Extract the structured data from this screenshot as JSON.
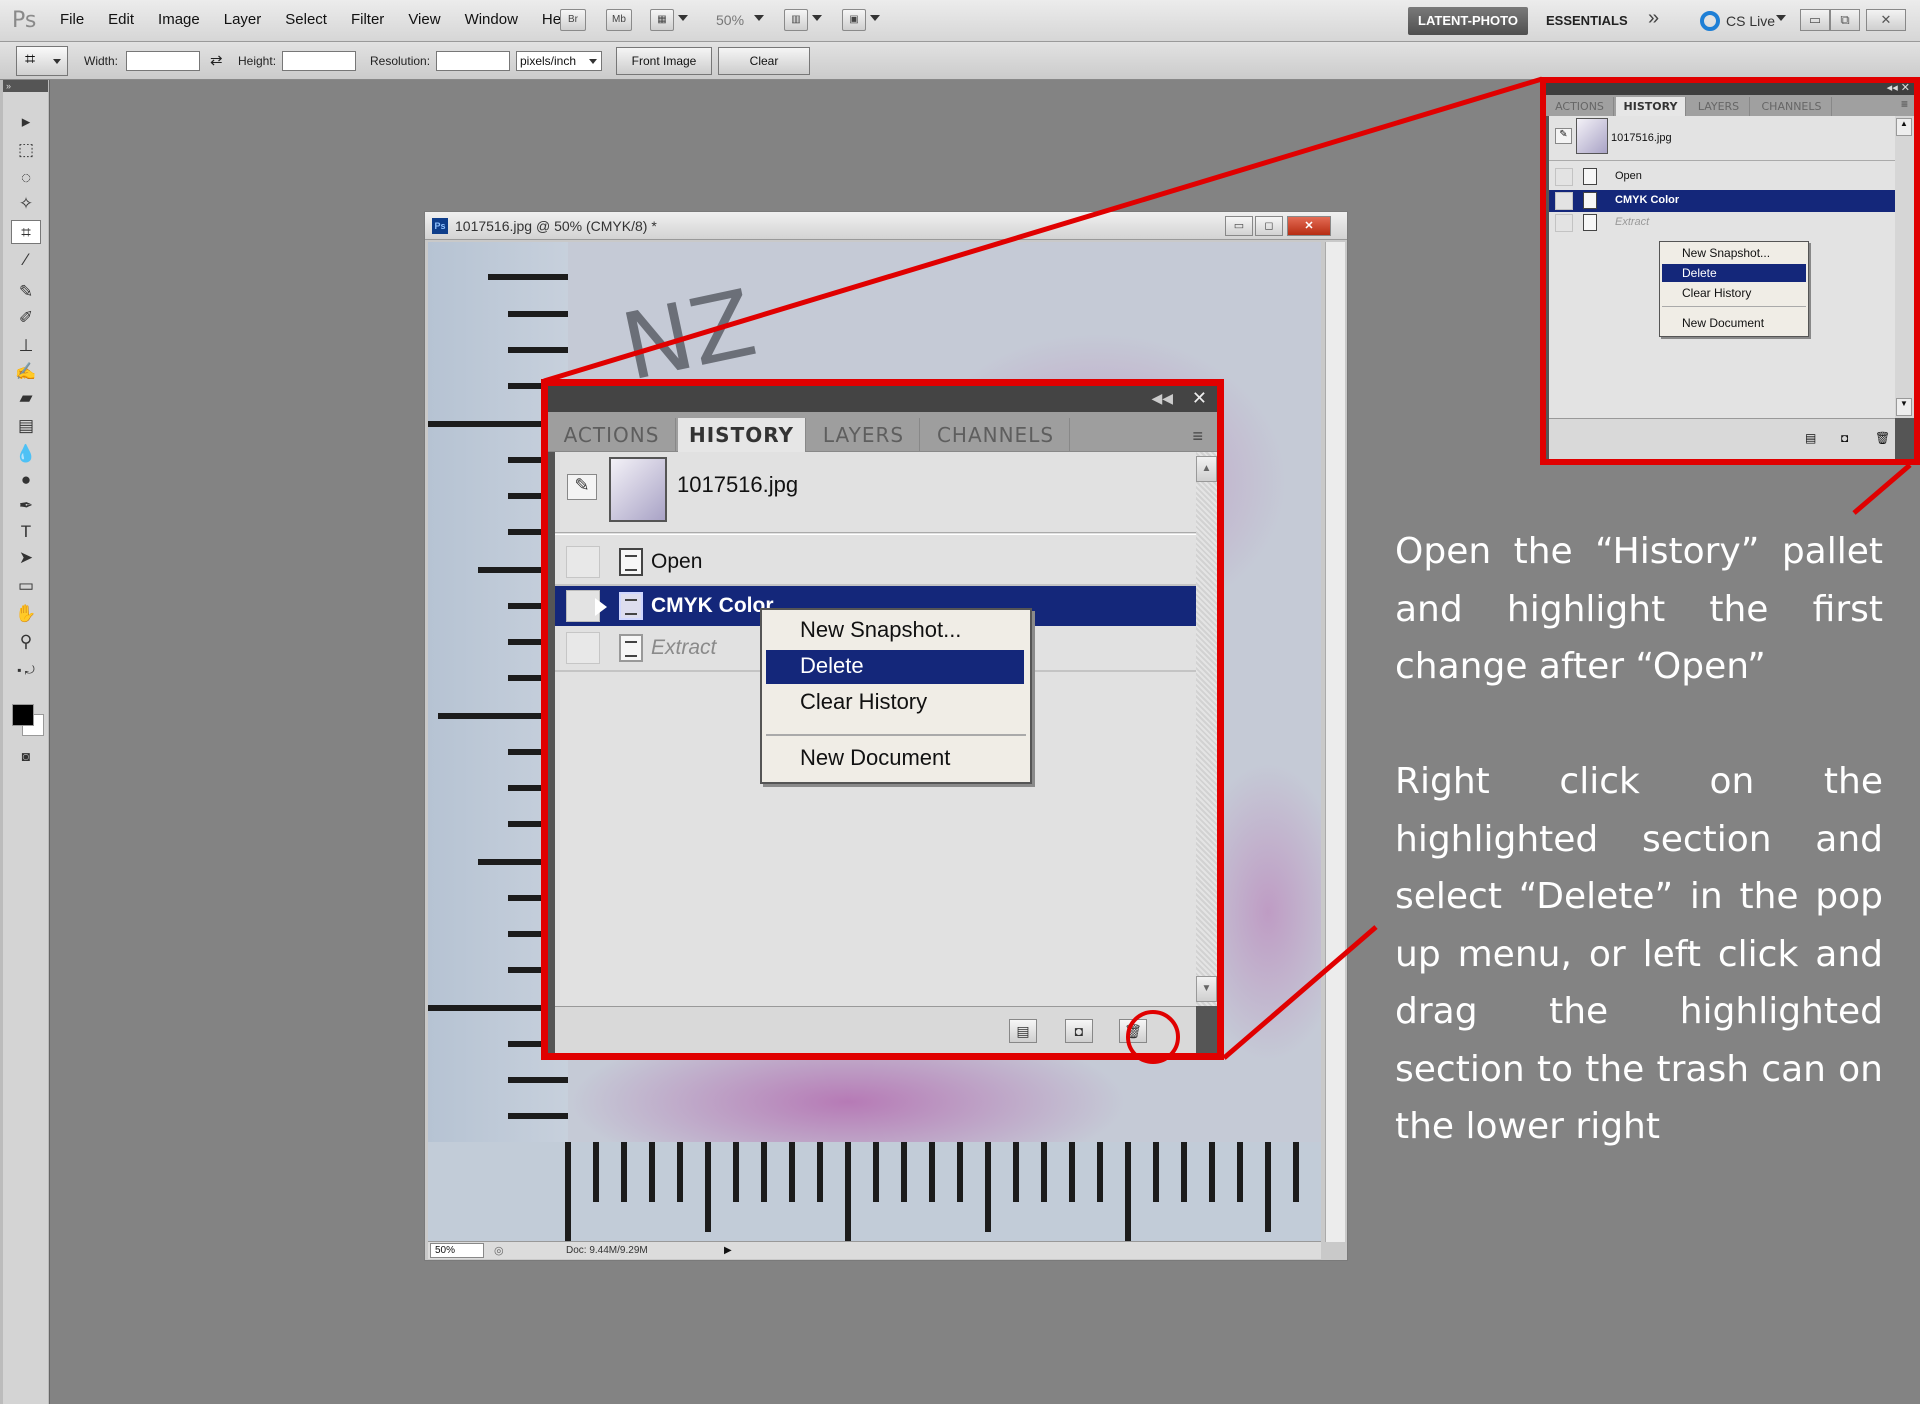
{
  "app": {
    "logo": "Ps",
    "menu": [
      "File",
      "Edit",
      "Image",
      "Layer",
      "Select",
      "Filter",
      "View",
      "Window",
      "Help"
    ],
    "bridge_btn": "Br",
    "minibridge_btn": "Mb",
    "zoom": "50%",
    "workspace": "LATENT-PHOTO",
    "essentials": "ESSENTIALS",
    "more": "»",
    "cs_live": "CS Live",
    "win_min": "▭",
    "win_restore": "⧉",
    "win_close": "✕"
  },
  "options": {
    "width_label": "Width:",
    "height_label": "Height:",
    "resolution_label": "Resolution:",
    "unit": "pixels/inch",
    "front_image": "Front Image",
    "clear": "Clear"
  },
  "document": {
    "title": "1017516.jpg @ 50% (CMYK/8) *",
    "zoom": "50%",
    "doc_info": "Doc: 9.44M/9.29M",
    "canvas_text": "NZ"
  },
  "history_panel": {
    "tabs": [
      "ACTIONS",
      "HISTORY",
      "LAYERS",
      "CHANNELS"
    ],
    "active_tab": "HISTORY",
    "snapshot": "1017516.jpg",
    "rows": [
      {
        "label": "Open",
        "state": "normal"
      },
      {
        "label": "CMYK Color",
        "state": "selected"
      },
      {
        "label": "Extract",
        "state": "dimmed"
      }
    ],
    "context_menu": [
      "New Snapshot...",
      "Delete",
      "Clear History",
      "New Document"
    ],
    "context_selected": "Delete"
  },
  "annotation": {
    "step1": "Open the “History” pallet and highlight the first change after “Open”",
    "step2": "Right click on the highlighted section and select “Delete” in the pop up menu, or left click and drag the highlighted section to the trash can on the lower right"
  },
  "colors": {
    "highlight_red": "#e00000",
    "selection_blue": "#14277a",
    "workspace_gray": "#838383"
  }
}
